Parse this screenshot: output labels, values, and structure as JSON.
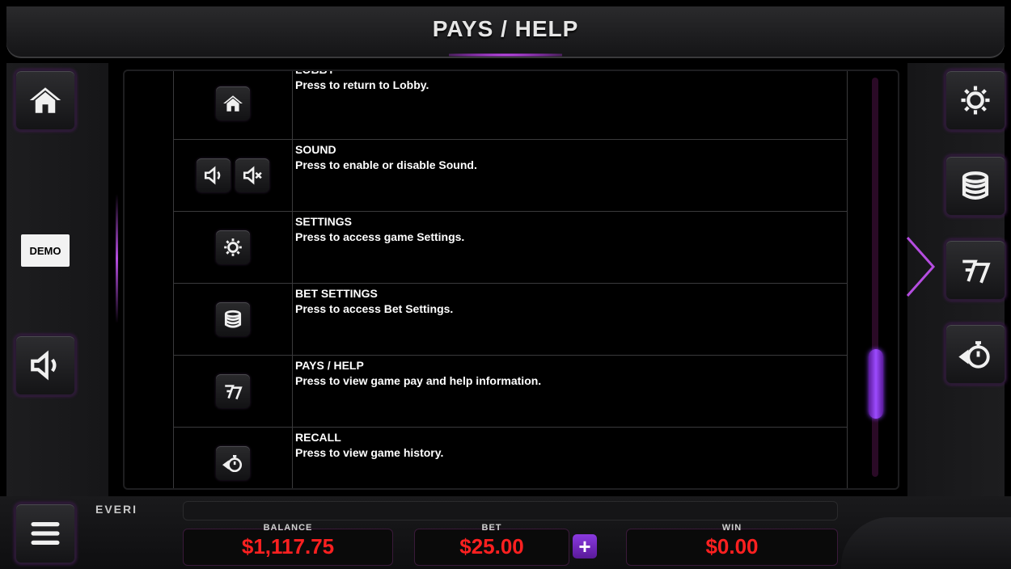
{
  "header": {
    "title": "PAYS / HELP"
  },
  "left_panel": {
    "demo_label": "DEMO"
  },
  "rows": [
    {
      "title": "LOBBY",
      "description": "Press to return to Lobby.",
      "icons": [
        "home-icon"
      ]
    },
    {
      "title": "SOUND",
      "description": "Press to enable or disable Sound.",
      "icons": [
        "speaker-icon",
        "speaker-mute-icon"
      ]
    },
    {
      "title": "SETTINGS",
      "description": "Press to access game Settings.",
      "icons": [
        "gear-icon"
      ]
    },
    {
      "title": "BET SETTINGS",
      "description": "Press to access Bet Settings.",
      "icons": [
        "coin-stack-icon"
      ]
    },
    {
      "title": "PAYS / HELP",
      "description": "Press to view game pay and help information.",
      "icons": [
        "sevens-icon"
      ]
    },
    {
      "title": "RECALL",
      "description": "Press to view game history.",
      "icons": [
        "recall-stopwatch-icon"
      ]
    }
  ],
  "footer": {
    "logo": "EVERI",
    "balance_label": "BALANCE",
    "balance_value": "$1,117.75",
    "bet_label": "BET",
    "bet_value": "$25.00",
    "win_label": "WIN",
    "win_value": "$0.00",
    "plus_label": "+"
  },
  "scroll": {
    "position": 0.85
  },
  "colors": {
    "accent": "#9c4bff",
    "value_red": "#ff2020"
  }
}
